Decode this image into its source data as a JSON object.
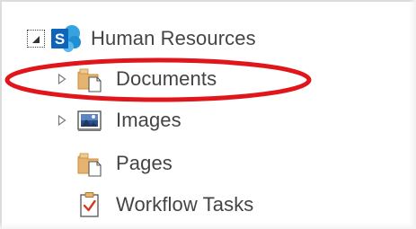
{
  "tree": {
    "root": {
      "label": "Human Resources",
      "icon": "sharepoint-site-icon",
      "expanded": true
    },
    "items": [
      {
        "label": "Documents",
        "icon": "document-library-icon",
        "expandable": true,
        "highlighted": true
      },
      {
        "label": "Images",
        "icon": "image-library-icon",
        "expandable": true
      },
      {
        "label": "Pages",
        "icon": "pages-library-icon",
        "expandable": false
      },
      {
        "label": "Workflow Tasks",
        "icon": "task-list-icon",
        "expandable": false
      }
    ]
  },
  "colors": {
    "highlight_ring": "#e0161b",
    "sharepoint_blue": "#1a74c4",
    "folder_tan": "#e6b46e",
    "text": "#444444"
  }
}
